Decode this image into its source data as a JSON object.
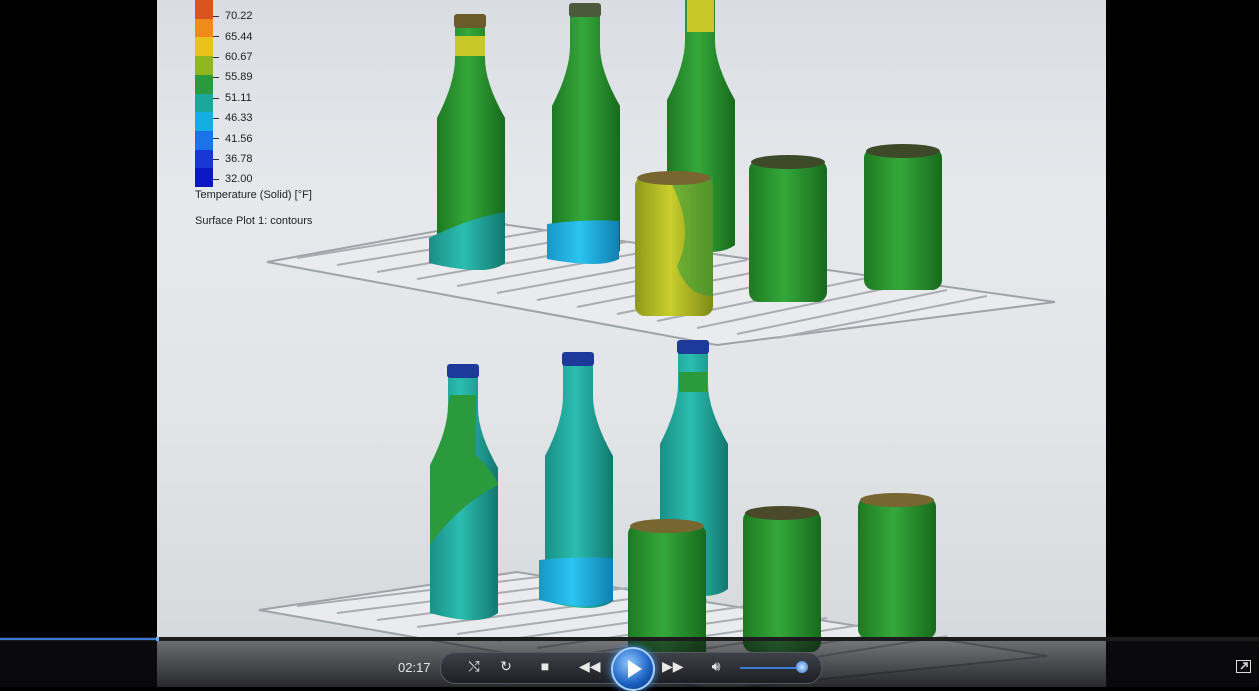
{
  "player": {
    "time": "02:17",
    "progress": 0.125,
    "volume": 0.9,
    "controls": {
      "switch_icon": "switch-icon",
      "repeat_icon": "repeat-icon",
      "stop_icon": "stop-icon",
      "rewind_icon": "rewind-icon",
      "play_icon": "play-icon",
      "forward_icon": "fast-forward-icon",
      "volume_icon": "speaker-icon",
      "fullscreen_icon": "fullscreen-icon"
    }
  },
  "legend": {
    "values": [
      "70.22",
      "65.44",
      "60.67",
      "55.89",
      "51.11",
      "46.33",
      "41.56",
      "36.78",
      "32.00"
    ],
    "colors": [
      "#d9531e",
      "#f08a1b",
      "#e8c21a",
      "#8fb51f",
      "#2a9a3c",
      "#1aa89a",
      "#14aee2",
      "#1c72e8",
      "#1637d4",
      "#0c18c4"
    ],
    "title": "Temperature (Solid) [°F]",
    "subtitle": "Surface Plot 1: contours"
  }
}
